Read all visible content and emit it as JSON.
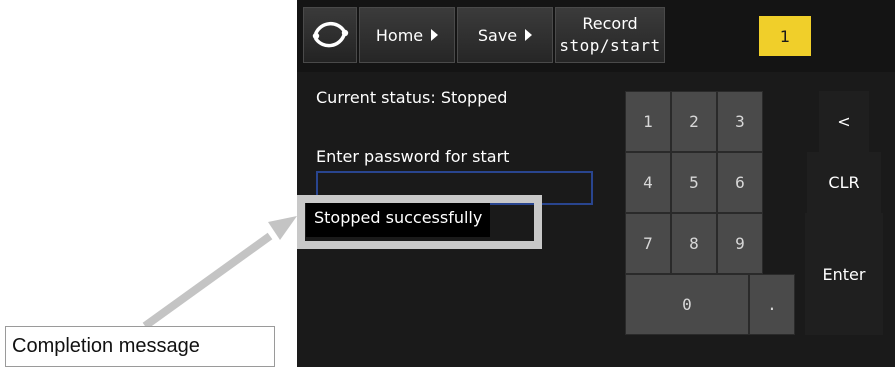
{
  "toolbar": {
    "logo_icon": "circle-arc-logo-icon",
    "home_label": "Home",
    "save_label": "Save",
    "record_label_line1": "Record",
    "record_label_line2": "stop/start",
    "badge_value": "1",
    "accent_color": "#f0cf2a"
  },
  "main": {
    "status_text": "Current status: Stopped",
    "password_label": "Enter password for start",
    "password_value": "",
    "message_text": "Stopped successfully",
    "input_border_color": "#29458f"
  },
  "keypad": {
    "keys": [
      "1",
      "2",
      "3",
      "4",
      "5",
      "6",
      "7",
      "8",
      "9",
      "0",
      "."
    ],
    "backspace_label": "<",
    "clear_label": "CLR",
    "enter_label": "Enter"
  },
  "annotation": {
    "callout_text": "Completion message",
    "frame_color": "#c8c8c8"
  }
}
